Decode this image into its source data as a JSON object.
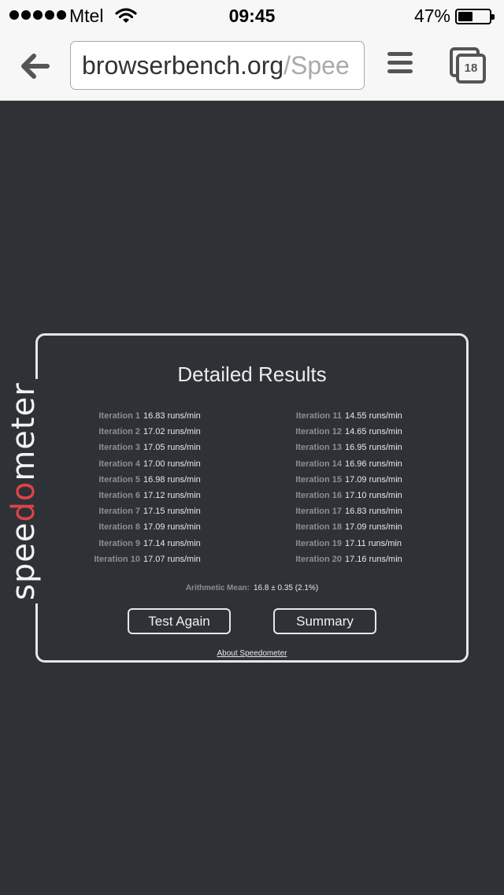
{
  "status_bar": {
    "carrier": "Mtel",
    "time": "09:45",
    "battery_percent": "47%",
    "battery_level": 0.44,
    "signal_bars": 5
  },
  "browser": {
    "url_primary": "browserbench.org",
    "url_faded": "/Spee",
    "tab_count": "18"
  },
  "icons": {
    "back": "back-arrow-icon",
    "menu": "hamburger-menu-icon",
    "tabs": "tabs-icon",
    "wifi": "wifi-icon"
  },
  "results": {
    "logo_before": "spee",
    "logo_highlight": "do",
    "logo_after": "meter",
    "heading": "Detailed Results",
    "left_column": [
      {
        "label": "Iteration 1",
        "value": "16.83 runs/min"
      },
      {
        "label": "Iteration 2",
        "value": "17.02 runs/min"
      },
      {
        "label": "Iteration 3",
        "value": "17.05 runs/min"
      },
      {
        "label": "Iteration 4",
        "value": "17.00 runs/min"
      },
      {
        "label": "Iteration 5",
        "value": "16.98 runs/min"
      },
      {
        "label": "Iteration 6",
        "value": "17.12 runs/min"
      },
      {
        "label": "Iteration 7",
        "value": "17.15 runs/min"
      },
      {
        "label": "Iteration 8",
        "value": "17.09 runs/min"
      },
      {
        "label": "Iteration 9",
        "value": "17.14 runs/min"
      },
      {
        "label": "Iteration 10",
        "value": "17.07 runs/min"
      }
    ],
    "right_column": [
      {
        "label": "Iteration 11",
        "value": "14.55 runs/min"
      },
      {
        "label": "Iteration 12",
        "value": "14.65 runs/min"
      },
      {
        "label": "Iteration 13",
        "value": "16.95 runs/min"
      },
      {
        "label": "Iteration 14",
        "value": "16.96 runs/min"
      },
      {
        "label": "Iteration 15",
        "value": "17.09 runs/min"
      },
      {
        "label": "Iteration 16",
        "value": "17.10 runs/min"
      },
      {
        "label": "Iteration 17",
        "value": "16.83 runs/min"
      },
      {
        "label": "Iteration 18",
        "value": "17.09 runs/min"
      },
      {
        "label": "Iteration 19",
        "value": "17.11 runs/min"
      },
      {
        "label": "Iteration 20",
        "value": "17.16 runs/min"
      }
    ],
    "mean_label": "Arithmetic Mean:",
    "mean_value": "16.8 ± 0.35 (2.1%)",
    "test_again_label": "Test Again",
    "summary_label": "Summary",
    "about_link": "About Speedometer"
  },
  "colors": {
    "page_background": "#2e3236",
    "logo_accent": "#e0434a",
    "panel_border": "#e6e6e6",
    "label_gray": "#8a8f94"
  }
}
